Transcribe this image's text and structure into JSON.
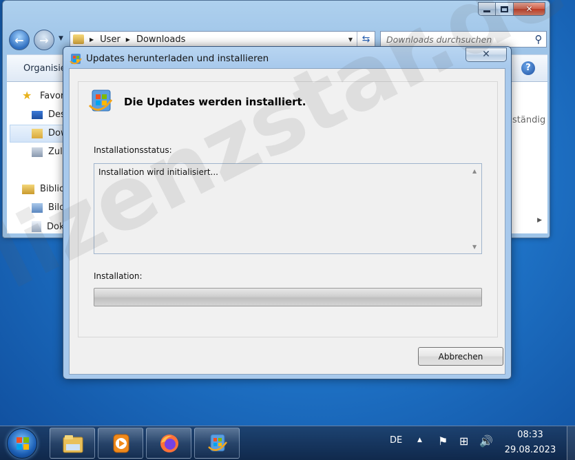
{
  "explorer": {
    "breadcrumb": [
      "User",
      "Downloads"
    ],
    "search_placeholder": "Downloads durchsuchen",
    "toolbar_organize": "Organisie",
    "help_label": "?",
    "nav_items": [
      "Favor",
      "Des",
      "Dow",
      "Zule",
      "Biblio",
      "Bilo",
      "Dok"
    ],
    "column_partial": "ständig"
  },
  "dialog": {
    "title": "Updates herunterladen und installieren",
    "heading": "Die Updates werden installiert.",
    "status_label": "Installationsstatus:",
    "status_text": "Installation wird initialisiert...",
    "install_label": "Installation:",
    "progress_fraction": 0,
    "cancel_label": "Abbrechen"
  },
  "watermark": "lizenzstar.de",
  "taskbar": {
    "language": "DE",
    "time": "08:33",
    "date": "29.08.2023"
  },
  "colors": {
    "accent": "#1f74c8",
    "progress_green": "#37c232"
  }
}
